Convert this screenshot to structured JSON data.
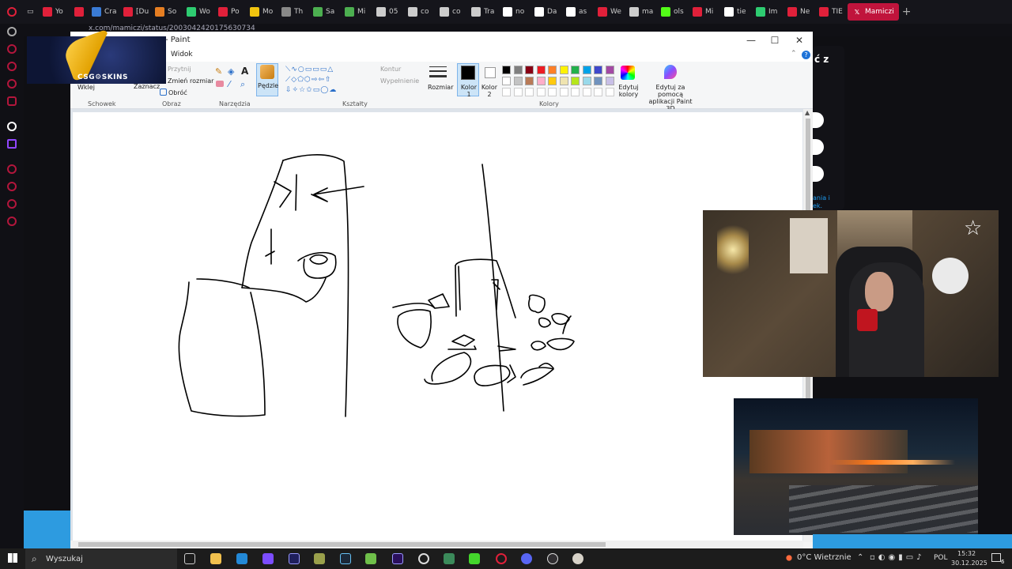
{
  "browser": {
    "tabs": [
      {
        "label": "Yo",
        "color": "#e0203a",
        "icon": "youtube-icon"
      },
      {
        "label": "",
        "color": "#e0203a",
        "icon": "youtube-icon"
      },
      {
        "label": "Cra",
        "color": "#3a7bd5",
        "icon": "site-icon"
      },
      {
        "label": "[Du",
        "color": "#e0203a",
        "icon": "youtube-icon"
      },
      {
        "label": "So",
        "color": "#e67e22",
        "icon": "site-icon"
      },
      {
        "label": "Wo",
        "color": "#2ecc71",
        "icon": "site-icon"
      },
      {
        "label": "Po",
        "color": "#e0203a",
        "icon": "site-icon"
      },
      {
        "label": "Mo",
        "color": "#f1c40f",
        "icon": "site-icon"
      },
      {
        "label": "Th",
        "color": "#888888",
        "icon": "site-icon"
      },
      {
        "label": "Sa",
        "color": "#4caf50",
        "icon": "sheets-icon"
      },
      {
        "label": "Mi",
        "color": "#4caf50",
        "icon": "sheets-icon"
      },
      {
        "label": "05",
        "color": "#cccccc",
        "icon": "doc-icon"
      },
      {
        "label": "co",
        "color": "#cccccc",
        "icon": "doc-icon"
      },
      {
        "label": "co",
        "color": "#cccccc",
        "icon": "doc-icon"
      },
      {
        "label": "Tra",
        "color": "#cccccc",
        "icon": "site-icon"
      },
      {
        "label": "no",
        "color": "#ffffff",
        "icon": "google-icon"
      },
      {
        "label": "Da",
        "color": "#ffffff",
        "icon": "tiktok-icon"
      },
      {
        "label": "as",
        "color": "#ffffff",
        "icon": "google-icon"
      },
      {
        "label": "We",
        "color": "#e0203a",
        "icon": "youtube-icon"
      },
      {
        "label": "ma",
        "color": "#cccccc",
        "icon": "doc-icon"
      },
      {
        "label": "ols",
        "color": "#53fc18",
        "icon": "kick-icon"
      },
      {
        "label": "Mi",
        "color": "#e0203a",
        "icon": "youtube-icon"
      },
      {
        "label": "tie",
        "color": "#ffffff",
        "icon": "google-icon"
      },
      {
        "label": "Im",
        "color": "#2ecc71",
        "icon": "site-icon"
      },
      {
        "label": "Ne",
        "color": "#e0203a",
        "icon": "youtube-icon"
      },
      {
        "label": "TIE",
        "color": "#e0203a",
        "icon": "youtube-icon"
      }
    ],
    "active_tab": {
      "label": "Mamiczi",
      "icon": "x-icon"
    },
    "address": "x.com/mamiczi/status/2003042420175630734"
  },
  "paint": {
    "title": "- Paint",
    "menu": {
      "view": "Widok"
    },
    "clipboard": {
      "paste": "Wklej",
      "group": "Schowek"
    },
    "image": {
      "crop": "Przytnij",
      "select": "Zaznacz",
      "resize": "Zmień rozmiar",
      "rotate": "Obróć",
      "group": "Obraz"
    },
    "tools": {
      "brushes": "Pędzle",
      "group": "Narzędzia"
    },
    "shapes": {
      "outline": "Kontur",
      "fill": "Wypełnienie",
      "group": "Kształty"
    },
    "size": "Rozmiar",
    "color1": "Kolor 1",
    "color2": "Kolor 2",
    "edit_colors": "Edytuj kolory",
    "paint3d": "Edytuj za pomocą aplikacji Paint 3D",
    "colors_group": "Kolory",
    "palette": [
      "#000000",
      "#7f7f7f",
      "#880015",
      "#ed1c24",
      "#ff7f27",
      "#fff200",
      "#22b14c",
      "#00a2e8",
      "#3f48cc",
      "#a349a4",
      "#ffffff",
      "#c3c3c3",
      "#b97a57",
      "#ffaec9",
      "#ffc90e",
      "#efe4b0",
      "#b5e61d",
      "#99d9ea",
      "#7092be",
      "#c8bfe7"
    ],
    "color1_value": "#000000",
    "color2_value": "#ffffff"
  },
  "overlay": {
    "logo_text": "CSG⚙SKINS"
  },
  "right_panel": {
    "partial_text_1": "ania i",
    "partial_text_2": "ek.",
    "partial_heading": "ć z"
  },
  "taskbar": {
    "search": "Wyszukaj",
    "weather": "0°C  Wietrznie",
    "language": "POL",
    "time": "15:32",
    "date": "30.12.2025",
    "notifications": "6"
  }
}
